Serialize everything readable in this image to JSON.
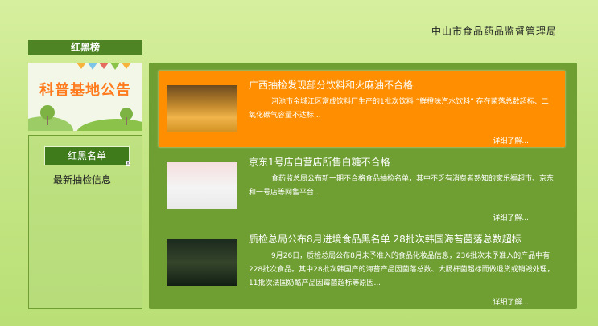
{
  "header": {
    "org": "中山市食品药品监督管理局"
  },
  "sidebar": {
    "title": "红黑榜",
    "banner_text": "科普基地公告",
    "button_label": "红黑名单",
    "link_label": "最新抽检信息"
  },
  "news": [
    {
      "title": "广西抽检发现部分饮料和火麻油不合格",
      "desc": "河池市金城江区富成饮料厂生产的1批次饮料 “鲜橙味汽水饮料” 存在菌落总数超标、二氧化碳气容量不达标...",
      "more": "详细了解..."
    },
    {
      "title": "京东1号店自营店所售白糖不合格",
      "desc": "食药监总局公布新一期不合格食品抽检名单，其中不乏有消费者熟知的家乐福超市、京东和一号店等网售平台...",
      "more": "详细了解..."
    },
    {
      "title": "质检总局公布8月进境食品黑名单 28批次韩国海苔菌落总数超标",
      "desc": "9月26日，质检总局公布8月未予准入的食品化妆品信息，236批次未予准入的产品中有228批次食品。其中28批次韩国产的海苔产品因菌落总数、大肠杆菌超标而做退货或销毁处理，11批次法国奶酪产品因霉菌超标等原因...",
      "more": "详细了解..."
    }
  ]
}
